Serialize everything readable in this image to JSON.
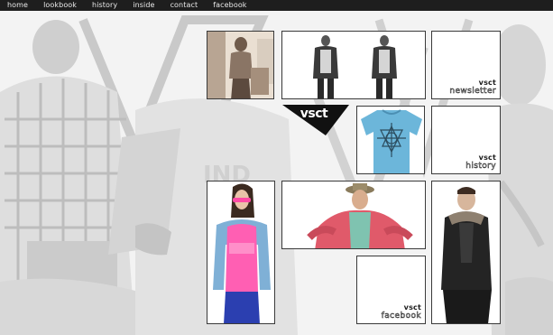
{
  "nav": {
    "items": [
      {
        "label": "home"
      },
      {
        "label": "lookbook"
      },
      {
        "label": "history"
      },
      {
        "label": "inside"
      },
      {
        "label": "contact"
      },
      {
        "label": "facebook"
      }
    ]
  },
  "logo": {
    "text": "vsct"
  },
  "tiles": {
    "newsletter": {
      "brand": "vsct",
      "caption": "newsletter"
    },
    "history": {
      "brand": "vsct",
      "caption": "history"
    },
    "facebook": {
      "brand": "vsct",
      "caption": "facebook"
    }
  },
  "colors": {
    "nav_background": "#1e1e1e",
    "page_background": "#f3f3f3",
    "tile_border": "#3a3a3a",
    "tshirt_blue": "#6cb6da",
    "tshirt_pink": "#ff5fb3",
    "jacket_red": "#e05a6a"
  }
}
